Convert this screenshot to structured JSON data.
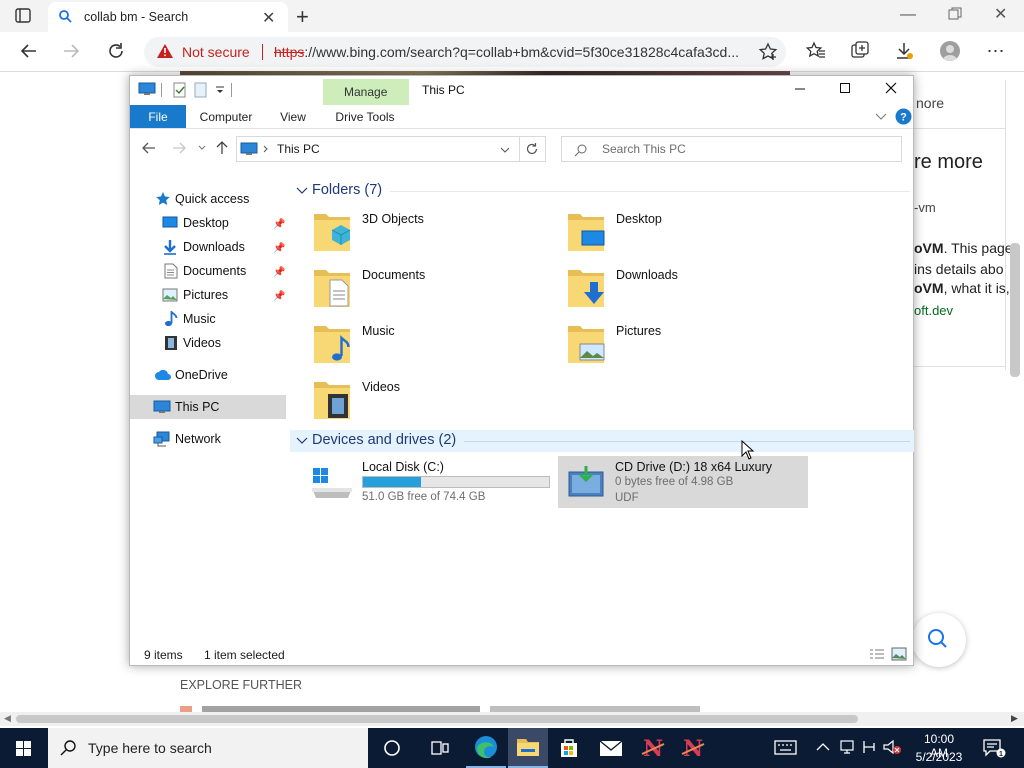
{
  "browser": {
    "tab_title": "collab bm - Search",
    "security_label": "Not secure",
    "url_scheme": "https",
    "url_rest": "://www.bing.com/search?q=collab+bm&cvid=5f30ce31828c4cafa3cd..."
  },
  "page_behind": {
    "snippet_more": "nore",
    "snippet_heading": "re more",
    "snippet_vm": "-vm",
    "snippet_l1_bold": "oVM",
    "snippet_l1": ". This page",
    "snippet_l2": "ins details abo",
    "snippet_l3_bold": "oVM",
    "snippet_l3": ", what it is,",
    "snippet_link": "oft.dev",
    "explore_further": "EXPLORE FURTHER"
  },
  "explorer": {
    "window_title": "This PC",
    "context_tab": "Manage",
    "ribbon_tabs": [
      "File",
      "Computer",
      "View",
      "Drive Tools"
    ],
    "address": "This PC",
    "search_placeholder": "Search This PC",
    "nav": {
      "quick_access": "Quick access",
      "desktop": "Desktop",
      "downloads": "Downloads",
      "documents": "Documents",
      "pictures": "Pictures",
      "music": "Music",
      "videos": "Videos",
      "onedrive": "OneDrive",
      "this_pc": "This PC",
      "network": "Network"
    },
    "folders_header": "Folders (7)",
    "folders": [
      "3D Objects",
      "Desktop",
      "Documents",
      "Downloads",
      "Music",
      "Pictures",
      "Videos"
    ],
    "devices_header": "Devices and drives (2)",
    "drives": [
      {
        "name": "Local Disk (C:)",
        "detail": "51.0 GB free of 74.4 GB",
        "used_fraction": 0.31
      },
      {
        "name": "CD Drive (D:) 18 x64 Luxury",
        "detail": "0 bytes free of 4.98 GB",
        "fs": "UDF"
      }
    ],
    "status_items": "9 items",
    "status_selected": "1 item selected"
  },
  "taskbar": {
    "search_placeholder": "Type here to search",
    "time": "10:00 AM",
    "date": "5/2/2023"
  },
  "colors": {
    "accent": "#0078d7",
    "file_tab": "#1979ca",
    "manage_tab": "#cdeebb",
    "selected_nav": "#d9d9d9",
    "folder_yellow": "#f8d775",
    "taskbar": "#0c1b34",
    "not_secure_red": "#c5221f"
  }
}
